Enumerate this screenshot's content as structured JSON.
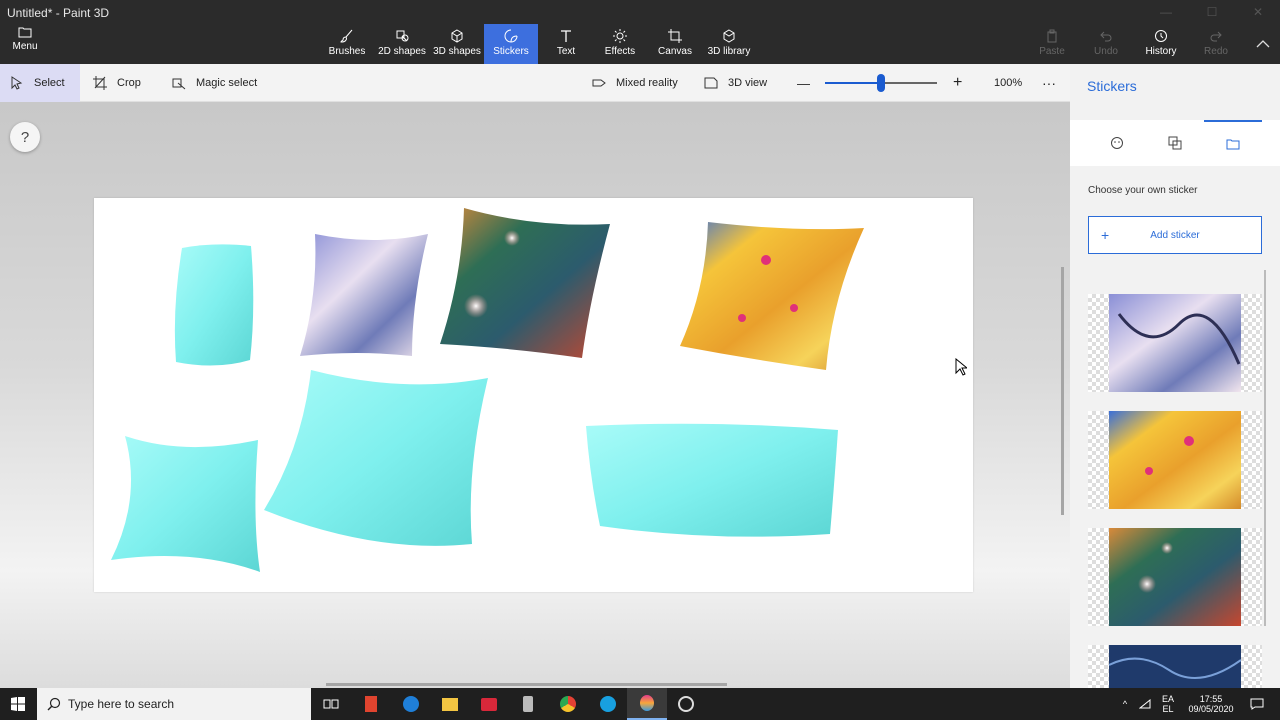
{
  "window": {
    "title": "Untitled* - Paint 3D"
  },
  "ribbon": {
    "menu_label": "Menu",
    "tools": [
      {
        "label": "Brushes"
      },
      {
        "label": "2D shapes"
      },
      {
        "label": "3D shapes"
      },
      {
        "label": "Stickers",
        "active": true
      },
      {
        "label": "Text"
      },
      {
        "label": "Effects"
      },
      {
        "label": "Canvas"
      },
      {
        "label": "3D library"
      }
    ],
    "right_tools": [
      {
        "label": "Paste",
        "enabled": false
      },
      {
        "label": "Undo",
        "enabled": false
      },
      {
        "label": "History",
        "enabled": true
      },
      {
        "label": "Redo",
        "enabled": false
      }
    ]
  },
  "commandbar": {
    "select_label": "Select",
    "crop_label": "Crop",
    "magic_select_label": "Magic select",
    "mixed_reality_label": "Mixed reality",
    "view3d_label": "3D view",
    "zoom_percent": "100%",
    "zoom_slider_fraction": 0.5,
    "minus": "—",
    "plus": "+",
    "more": "···"
  },
  "workspace": {
    "help_label": "?"
  },
  "panel": {
    "title": "Stickers",
    "tabs": [
      "sticker-icon",
      "texture-icon",
      "custom-folder-icon"
    ],
    "subtitle": "Choose your own sticker",
    "add_label": "Add sticker",
    "add_plus": "+"
  },
  "taskbar": {
    "search_placeholder": "Type here to search",
    "lang_top": "EA",
    "lang_bottom": "EL",
    "time": "17:55",
    "date": "09/05/2020"
  },
  "colors": {
    "accent": "#3d6fde",
    "pillow": "#7ff0ee",
    "panel_title": "#2b6cd8"
  }
}
